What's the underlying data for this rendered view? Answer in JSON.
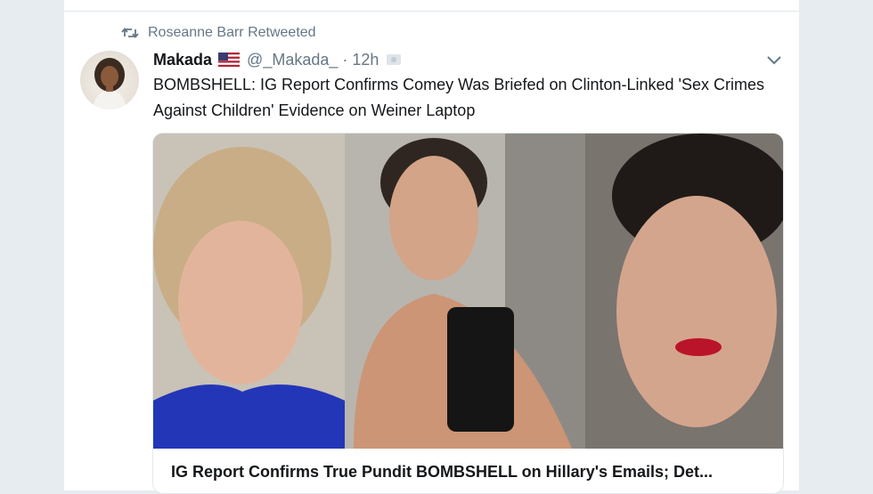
{
  "retweet": {
    "icon": "retweet-icon",
    "label": "Roseanne Barr Retweeted"
  },
  "tweet": {
    "author_name": "Makada",
    "flag_icon": "us-flag-icon",
    "handle": "@_Makada_",
    "separator": "·",
    "time": "12h",
    "text": "BOMBSHELL: IG Report Confirms Comey Was Briefed on Clinton-Linked 'Sex Crimes Against Children' Evidence on Weiner Laptop",
    "caret_icon": "chevron-down-icon"
  },
  "card": {
    "title": "IG Report Confirms True Pundit BOMBSHELL on Hillary's Emails; Det..."
  },
  "colors": {
    "background": "#e6ecf0",
    "text_primary": "#14171a",
    "text_secondary": "#657786",
    "border": "#e1e8ed"
  }
}
